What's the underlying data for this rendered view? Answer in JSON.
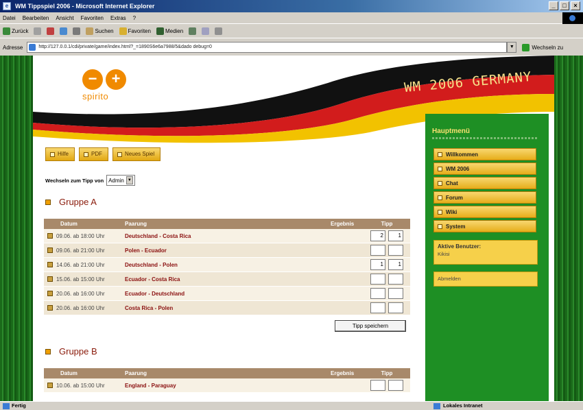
{
  "window": {
    "title": "WM Tippspiel 2006 - Microsoft Internet Explorer",
    "controls": [
      "_",
      "□",
      "×"
    ]
  },
  "menu": [
    "Datei",
    "Bearbeiten",
    "Ansicht",
    "Favoriten",
    "Extras",
    "?"
  ],
  "toolbar": {
    "back": "Zurück",
    "search": "Suchen",
    "favorites": "Favoriten",
    "media": "Medien"
  },
  "address": {
    "label": "Adresse",
    "url": "http://127.0.0.1/cdi/private/game/index.html?_=1890S6e6a7988/5&dado debug=0",
    "go": "Wechseln zu"
  },
  "header": {
    "logo_text": "spirito",
    "banner": "WM 2006 GERMANY"
  },
  "buttons": [
    "Hilfe",
    "PDF",
    "Neues Spiel"
  ],
  "tipp_switch": {
    "label": "Wechseln zum Tipp von",
    "value": "Admin"
  },
  "table_headers": {
    "date": "Datum",
    "match": "Paarung",
    "result": "Ergebnis",
    "tipp": "Tipp"
  },
  "group_a": {
    "title": "Gruppe A",
    "rows": [
      {
        "date": "09.06. ab 18:00 Uhr",
        "match": "Deutschland - Costa Rica",
        "t1": "2",
        "t2": "1"
      },
      {
        "date": "09.06. ab 21:00 Uhr",
        "match": "Polen - Ecuador",
        "t1": "",
        "t2": ""
      },
      {
        "date": "14.06. ab 21:00 Uhr",
        "match": "Deutschland - Polen",
        "t1": "1",
        "t2": "1"
      },
      {
        "date": "15.06. ab 15:00 Uhr",
        "match": "Ecuador - Costa Rica",
        "t1": "",
        "t2": ""
      },
      {
        "date": "20.06. ab 16:00 Uhr",
        "match": "Ecuador - Deutschland",
        "t1": "",
        "t2": ""
      },
      {
        "date": "20.06. ab 16:00 Uhr",
        "match": "Costa Rica - Polen",
        "t1": "",
        "t2": ""
      }
    ],
    "save": "Tipp speichern"
  },
  "group_b": {
    "title": "Gruppe B",
    "rows": [
      {
        "date": "10.06. ab 15:00 Uhr",
        "match": "England - Paraguay",
        "t1": "",
        "t2": ""
      }
    ]
  },
  "sidebar": {
    "title": "Hauptmenü",
    "items": [
      "Willkommen",
      "WM 2006",
      "Chat",
      "Forum",
      "Wiki",
      "System"
    ],
    "active_users_title": "Aktive Benutzer:",
    "active_users": "Kikisi",
    "logout": "Abmelden"
  },
  "status": {
    "left": "Fertig",
    "right": "Lokales Intranet"
  },
  "colors": {
    "grass": "#1b6b1b",
    "sidebar": "#1e8f24",
    "button_gold": "#e6ad1a",
    "accent_orange": "#f08a00",
    "match_text": "#8a0f0f"
  }
}
